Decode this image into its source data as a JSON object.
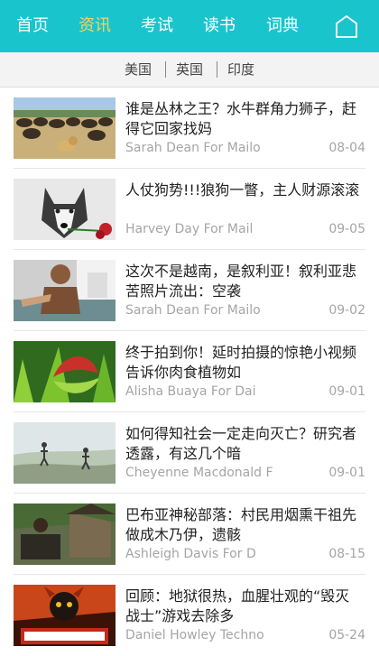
{
  "nav": {
    "tabs": [
      {
        "label": "首页",
        "active": false
      },
      {
        "label": "资讯",
        "active": true
      },
      {
        "label": "考试",
        "active": false
      },
      {
        "label": "读书",
        "active": false
      },
      {
        "label": "词典",
        "active": false
      }
    ],
    "home_icon": "home-icon"
  },
  "subnav": {
    "items": [
      "美国",
      "英国",
      "印度"
    ]
  },
  "articles": [
    {
      "title": "谁是丛林之王？水牛群角力狮子，赶得它回家找妈",
      "author": "Sarah Dean For Mailo",
      "date": "08-04",
      "thumb": "buffalo-lion"
    },
    {
      "title": "人仗狗势!!!狼狗一瞥，主人财源滚滚",
      "author": "Harvey Day For Mail",
      "date": "09-05",
      "thumb": "husky-rose"
    },
    {
      "title": "这次不是越南，是叙利亚！叙利亚悲苦照片流出：空袭",
      "author": "Sarah Dean For Mailo",
      "date": "09-02",
      "thumb": "child-airstrike"
    },
    {
      "title": "终于拍到你！延时拍摄的惊艳小视频告诉你肉食植物如",
      "author": "Alisha Buaya For Dai",
      "date": "09-01",
      "thumb": "venus-flytrap"
    },
    {
      "title": "如何得知社会一定走向灭亡？研究者透露，有这几个暗",
      "author": "Cheyenne Macdonald F",
      "date": "09-01",
      "thumb": "ancient-painting"
    },
    {
      "title": "巴布亚神秘部落：村民用烟熏干祖先做成木乃伊，遗骸",
      "author": "Ashleigh Davis For D",
      "date": "08-15",
      "thumb": "mummy-village"
    },
    {
      "title": "回顾：地狱很热，血腥壮观的“毁灭战士”游戏去除多",
      "author": "Daniel Howley Techno",
      "date": "05-24",
      "thumb": "doom-cover"
    }
  ]
}
